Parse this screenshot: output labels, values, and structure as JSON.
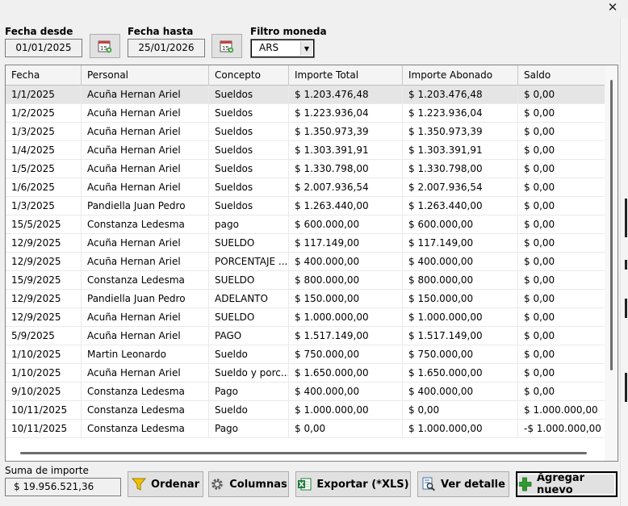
{
  "window": {
    "close_label": "✕"
  },
  "filters": {
    "fecha_desde_label": "Fecha desde",
    "fecha_desde_value": "01/01/2025",
    "fecha_hasta_label": "Fecha hasta",
    "fecha_hasta_value": "25/01/2026",
    "moneda_label": "Filtro moneda",
    "moneda_value": "ARS",
    "calendar_icon_text": "15"
  },
  "table": {
    "columns": [
      "Fecha",
      "Personal",
      "Concepto",
      "Importe Total",
      "Importe Abonado",
      "Saldo"
    ],
    "rows": [
      [
        "1/1/2025",
        "Acuña Hernan Ariel",
        "Sueldos",
        "$ 1.203.476,48",
        "$ 1.203.476,48",
        "$ 0,00"
      ],
      [
        "1/2/2025",
        "Acuña Hernan Ariel",
        "Sueldos",
        "$ 1.223.936,04",
        "$ 1.223.936,04",
        "$ 0,00"
      ],
      [
        "1/3/2025",
        "Acuña Hernan Ariel",
        "Sueldos",
        "$ 1.350.973,39",
        "$ 1.350.973,39",
        "$ 0,00"
      ],
      [
        "1/4/2025",
        "Acuña Hernan Ariel",
        "Sueldos",
        "$ 1.303.391,91",
        "$ 1.303.391,91",
        "$ 0,00"
      ],
      [
        "1/5/2025",
        "Acuña Hernan Ariel",
        "Sueldos",
        "$ 1.330.798,00",
        "$ 1.330.798,00",
        "$ 0,00"
      ],
      [
        "1/6/2025",
        "Acuña Hernan Ariel",
        "Sueldos",
        "$ 2.007.936,54",
        "$ 2.007.936,54",
        "$ 0,00"
      ],
      [
        "1/3/2025",
        "Pandiella Juan Pedro",
        "Sueldos",
        "$ 1.263.440,00",
        "$ 1.263.440,00",
        "$ 0,00"
      ],
      [
        "15/5/2025",
        "Constanza Ledesma",
        "pago",
        "$ 600.000,00",
        "$ 600.000,00",
        "$ 0,00"
      ],
      [
        "12/9/2025",
        "Acuña Hernan Ariel",
        "SUELDO",
        "$ 117.149,00",
        "$ 117.149,00",
        "$ 0,00"
      ],
      [
        "12/9/2025",
        "Acuña Hernan Ariel",
        "PORCENTAJE ...",
        "$ 400.000,00",
        "$ 400.000,00",
        "$ 0,00"
      ],
      [
        "15/9/2025",
        "Constanza Ledesma",
        "SUELDO",
        "$ 800.000,00",
        "$ 800.000,00",
        "$ 0,00"
      ],
      [
        "12/9/2025",
        "Pandiella Juan Pedro",
        "ADELANTO",
        "$ 150.000,00",
        "$ 150.000,00",
        "$ 0,00"
      ],
      [
        "12/9/2025",
        "Acuña Hernan Ariel",
        "SUELDO",
        "$ 1.000.000,00",
        "$ 1.000.000,00",
        "$ 0,00"
      ],
      [
        "5/9/2025",
        "Acuña Hernan Ariel",
        "PAGO",
        "$ 1.517.149,00",
        "$ 1.517.149,00",
        "$ 0,00"
      ],
      [
        "1/10/2025",
        "Martin Leonardo",
        "Sueldo",
        "$ 750.000,00",
        "$ 750.000,00",
        "$ 0,00"
      ],
      [
        "1/10/2025",
        "Acuña Hernan Ariel",
        "Sueldo y porc...",
        "$ 1.650.000,00",
        "$ 1.650.000,00",
        "$ 0,00"
      ],
      [
        "9/10/2025",
        "Constanza Ledesma",
        "Pago",
        "$ 400.000,00",
        "$ 400.000,00",
        "$ 0,00"
      ],
      [
        "10/11/2025",
        "Constanza Ledesma",
        "Sueldo",
        "$ 1.000.000,00",
        "$ 0,00",
        "$ 1.000.000,00"
      ],
      [
        "10/11/2025",
        "Constanza Ledesma",
        "Pago",
        "$ 0,00",
        "$ 1.000.000,00",
        "-$ 1.000.000,00"
      ]
    ]
  },
  "footer": {
    "sum_label": "Suma de importe",
    "sum_value": "$ 19.956.521,36",
    "ordenar_label": "Ordenar",
    "columnas_label": "Columnas",
    "exportar_label": "Exportar (*XLS)",
    "ver_detalle_label": "Ver detalle",
    "agregar_label": "Agregar nuevo"
  },
  "colors": {
    "window_bg": "#f0f0f0",
    "grid_bg": "#ffffff",
    "selected_row": "#e5e5e5",
    "filter_icon": "#f2c200",
    "add_icon": "#2e9b2e",
    "excel_icon": "#1f7a3a"
  },
  "icons": [
    "close-icon",
    "calendar-icon",
    "chevron-down-icon",
    "filter-icon",
    "gear-icon",
    "excel-icon",
    "magnifier-document-icon",
    "plus-icon"
  ]
}
